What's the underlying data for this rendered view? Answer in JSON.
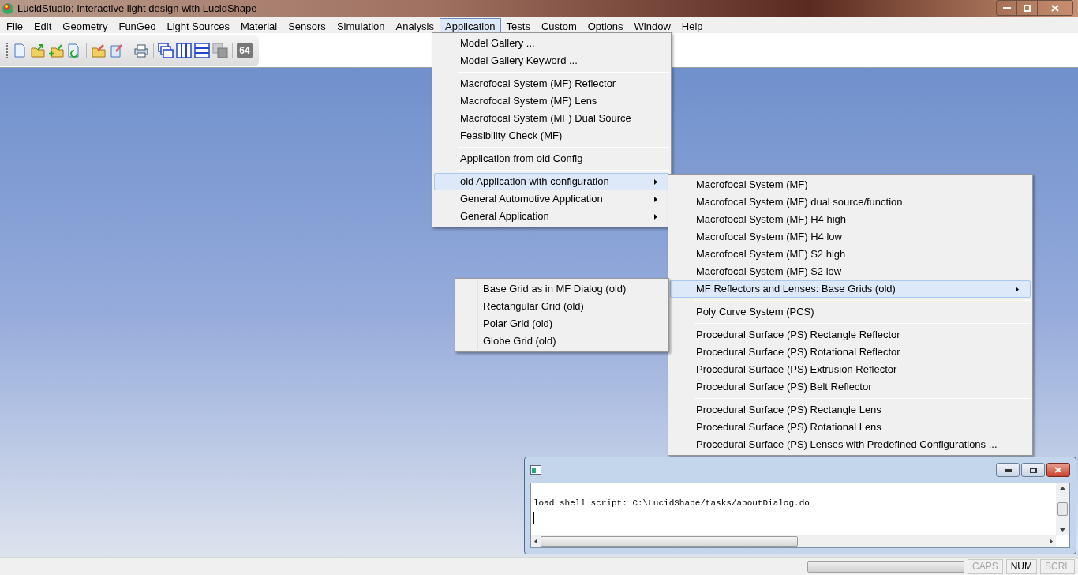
{
  "window": {
    "title": "LucidStudio; Interactive light design with LucidShape"
  },
  "menubar": [
    {
      "label": "File",
      "selected": false
    },
    {
      "label": "Edit",
      "selected": false
    },
    {
      "label": "Geometry",
      "selected": false
    },
    {
      "label": "FunGeo",
      "selected": false
    },
    {
      "label": "Light Sources",
      "selected": false
    },
    {
      "label": "Material",
      "selected": false
    },
    {
      "label": "Sensors",
      "selected": false
    },
    {
      "label": "Simulation",
      "selected": false
    },
    {
      "label": "Analysis",
      "selected": false
    },
    {
      "label": "Application",
      "selected": true
    },
    {
      "label": "Tests",
      "selected": false
    },
    {
      "label": "Custom",
      "selected": false
    },
    {
      "label": "Options",
      "selected": false
    },
    {
      "label": "Window",
      "selected": false
    },
    {
      "label": "Help",
      "selected": false
    }
  ],
  "toolbar": {
    "badge": "64"
  },
  "application_menu": {
    "groups": [
      [
        {
          "label": "Model Gallery ...",
          "has_submenu": false,
          "selected": false
        },
        {
          "label": "Model Gallery Keyword ...",
          "has_submenu": false,
          "selected": false
        }
      ],
      [
        {
          "label": "Macrofocal System (MF) Reflector",
          "has_submenu": false,
          "selected": false
        },
        {
          "label": "Macrofocal System (MF) Lens",
          "has_submenu": false,
          "selected": false
        },
        {
          "label": "Macrofocal System (MF) Dual Source",
          "has_submenu": false,
          "selected": false
        },
        {
          "label": "Feasibility Check (MF)",
          "has_submenu": false,
          "selected": false
        }
      ],
      [
        {
          "label": "Application from old Config",
          "has_submenu": false,
          "selected": false
        }
      ],
      [
        {
          "label": "old Application with configuration",
          "has_submenu": true,
          "selected": true
        },
        {
          "label": "General Automotive Application",
          "has_submenu": true,
          "selected": false
        },
        {
          "label": "General Application",
          "has_submenu": true,
          "selected": false
        }
      ]
    ]
  },
  "configuration_submenu": {
    "groups": [
      [
        {
          "label": "Macrofocal System (MF)",
          "has_submenu": false,
          "selected": false
        },
        {
          "label": "Macrofocal System (MF) dual source/function",
          "has_submenu": false,
          "selected": false
        },
        {
          "label": "Macrofocal System (MF) H4 high",
          "has_submenu": false,
          "selected": false
        },
        {
          "label": "Macrofocal System (MF) H4 low",
          "has_submenu": false,
          "selected": false
        },
        {
          "label": "Macrofocal System (MF) S2 high",
          "has_submenu": false,
          "selected": false
        },
        {
          "label": "Macrofocal System (MF) S2 low",
          "has_submenu": false,
          "selected": false
        },
        {
          "label": "MF Reflectors and Lenses: Base Grids (old)",
          "has_submenu": true,
          "selected": true
        }
      ],
      [
        {
          "label": "Poly Curve System (PCS)",
          "has_submenu": false,
          "selected": false
        }
      ],
      [
        {
          "label": "Procedural Surface (PS) Rectangle Reflector",
          "has_submenu": false,
          "selected": false
        },
        {
          "label": "Procedural Surface (PS) Rotational Reflector",
          "has_submenu": false,
          "selected": false
        },
        {
          "label": "Procedural Surface (PS) Extrusion Reflector",
          "has_submenu": false,
          "selected": false
        },
        {
          "label": "Procedural Surface (PS) Belt Reflector",
          "has_submenu": false,
          "selected": false
        }
      ],
      [
        {
          "label": "Procedural Surface (PS) Rectangle Lens",
          "has_submenu": false,
          "selected": false
        },
        {
          "label": "Procedural Surface (PS) Rotational Lens",
          "has_submenu": false,
          "selected": false
        },
        {
          "label": "Procedural Surface (PS) Lenses with Predefined Configurations ...",
          "has_submenu": false,
          "selected": false
        }
      ]
    ]
  },
  "base_grids_submenu": {
    "groups": [
      [
        {
          "label": "Base Grid as in MF Dialog (old)",
          "has_submenu": false,
          "selected": false
        },
        {
          "label": "Rectangular Grid (old)",
          "has_submenu": false,
          "selected": false
        },
        {
          "label": "Polar Grid (old)",
          "has_submenu": false,
          "selected": false
        },
        {
          "label": "Globe Grid (old)",
          "has_submenu": false,
          "selected": false
        }
      ]
    ]
  },
  "console": {
    "lines": [
      "load shell script: C:\\LucidShape/tasks/aboutDialog.do"
    ]
  },
  "status_bar": {
    "progress": {
      "level": 0
    },
    "indicators": [
      {
        "label": "CAPS",
        "active": false
      },
      {
        "label": "NUM",
        "active": true
      },
      {
        "label": "SCRL",
        "active": false
      }
    ]
  }
}
